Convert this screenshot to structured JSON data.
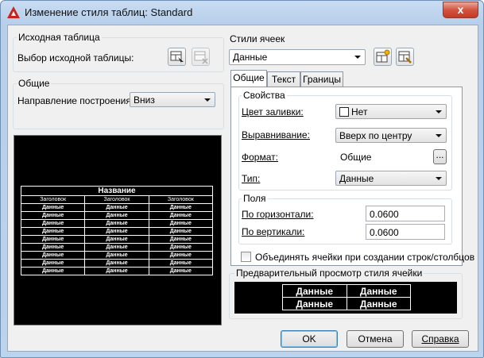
{
  "window": {
    "title": "Изменение стиля таблиц: Standard",
    "close_label": "x"
  },
  "source_table": {
    "group_label": "Исходная таблица",
    "select_label": "Выбор исходной таблицы:"
  },
  "general": {
    "group_label": "Общие",
    "direction_label": "Направление построения:",
    "direction_value": "Вниз"
  },
  "preview": {
    "title": "Название",
    "header_cells": [
      "Заголовок",
      "Заголовок",
      "Заголовок"
    ],
    "data_rows": [
      [
        "Данные",
        "Данные",
        "Данные"
      ],
      [
        "Данные",
        "Данные",
        "Данные"
      ],
      [
        "Данные",
        "Данные",
        "Данные"
      ],
      [
        "Данные",
        "Данные",
        "Данные"
      ],
      [
        "Данные",
        "Данные",
        "Данные"
      ],
      [
        "Данные",
        "Данные",
        "Данные"
      ],
      [
        "Данные",
        "Данные",
        "Данные"
      ],
      [
        "Данные",
        "Данные",
        "Данные"
      ],
      [
        "Данные",
        "Данные",
        "Данные"
      ]
    ]
  },
  "cell_styles": {
    "group_label": "Стили ячеек",
    "selected_style": "Данные"
  },
  "tabs": [
    "Общие",
    "Текст",
    "Границы"
  ],
  "properties": {
    "group_label": "Свойства",
    "fill_color_label": "Цвет заливки:",
    "fill_color_value": "Нет",
    "alignment_label": "Выравнивание:",
    "alignment_value": "Вверх по центру",
    "format_label": "Формат:",
    "format_value": "Общие",
    "format_button": "...",
    "type_label": "Тип:",
    "type_value": "Данные"
  },
  "margins": {
    "group_label": "Поля",
    "horizontal_label": "По горизонтали:",
    "horizontal_value": "0.0600",
    "vertical_label": "По вертикали:",
    "vertical_value": "0.0600"
  },
  "merge_checkbox_label": "Объединять ячейки при создании строк/столбцов",
  "cell_preview": {
    "group_label": "Предварительный просмотр стиля ячейки",
    "cells": [
      [
        "Данные",
        "Данные"
      ],
      [
        "Данные",
        "Данные"
      ]
    ]
  },
  "buttons": {
    "ok": "OK",
    "cancel": "Отмена",
    "help": "Справка"
  }
}
